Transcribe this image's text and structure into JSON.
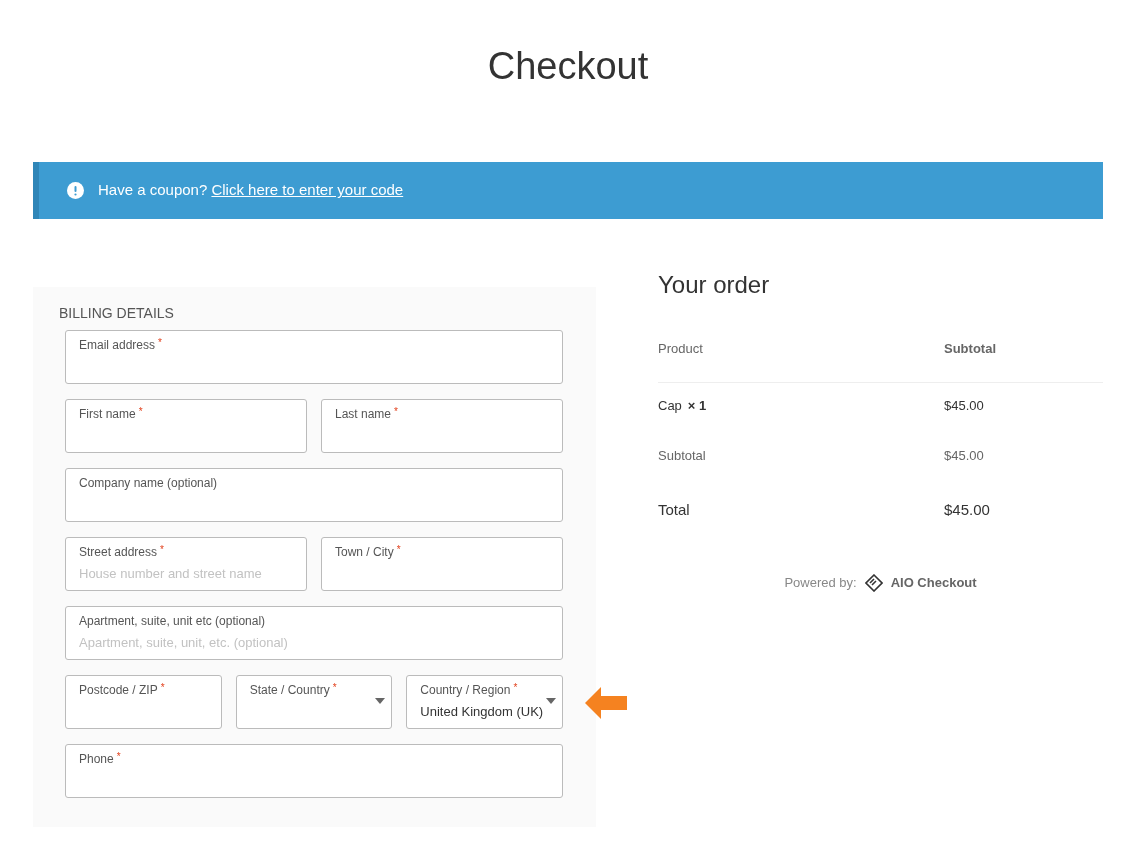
{
  "page_title": "Checkout",
  "notice": {
    "text": "Have a coupon?",
    "link": "Click here to enter your code"
  },
  "billing": {
    "heading": "BILLING DETAILS",
    "rows": [
      [
        {
          "kind": "text",
          "label": "Email address",
          "required_mark": "*"
        }
      ],
      [
        {
          "kind": "text",
          "label": "First name",
          "required_mark": "*"
        },
        {
          "kind": "text",
          "label": "Last name",
          "required_mark": "*"
        }
      ],
      [
        {
          "kind": "text",
          "label": "Company name (optional)"
        }
      ],
      [
        {
          "kind": "text",
          "label": "Street address",
          "required_mark": "*",
          "placeholder": "House number and street name"
        },
        {
          "kind": "text",
          "label": "Town / City",
          "required_mark": "*"
        }
      ],
      [
        {
          "kind": "text",
          "label": "Apartment, suite, unit etc (optional)",
          "placeholder": "Apartment, suite, unit, etc. (optional)"
        }
      ],
      [
        {
          "kind": "text",
          "label": "Postcode / ZIP",
          "required_mark": "*"
        },
        {
          "kind": "select",
          "label": "State / Country",
          "required_mark": "*"
        },
        {
          "kind": "select",
          "label": "Country / Region",
          "required_mark": "*",
          "value": "United Kingdom (UK)"
        }
      ],
      [
        {
          "kind": "text",
          "label": "Phone",
          "required_mark": "*"
        }
      ]
    ]
  },
  "order": {
    "heading": "Your order",
    "columns": [
      "Product",
      "Subtotal"
    ],
    "rows": [
      {
        "kind": "item",
        "label": "Cap",
        "quantity": "× 1",
        "amount": "$45.00"
      },
      {
        "kind": "subtotal",
        "label": "Subtotal",
        "amount": "$45.00"
      },
      {
        "kind": "total",
        "label": "Total",
        "amount": "$45.00"
      }
    ],
    "powered_by": {
      "text": "Powered by:",
      "brand": "AIO Checkout"
    }
  }
}
